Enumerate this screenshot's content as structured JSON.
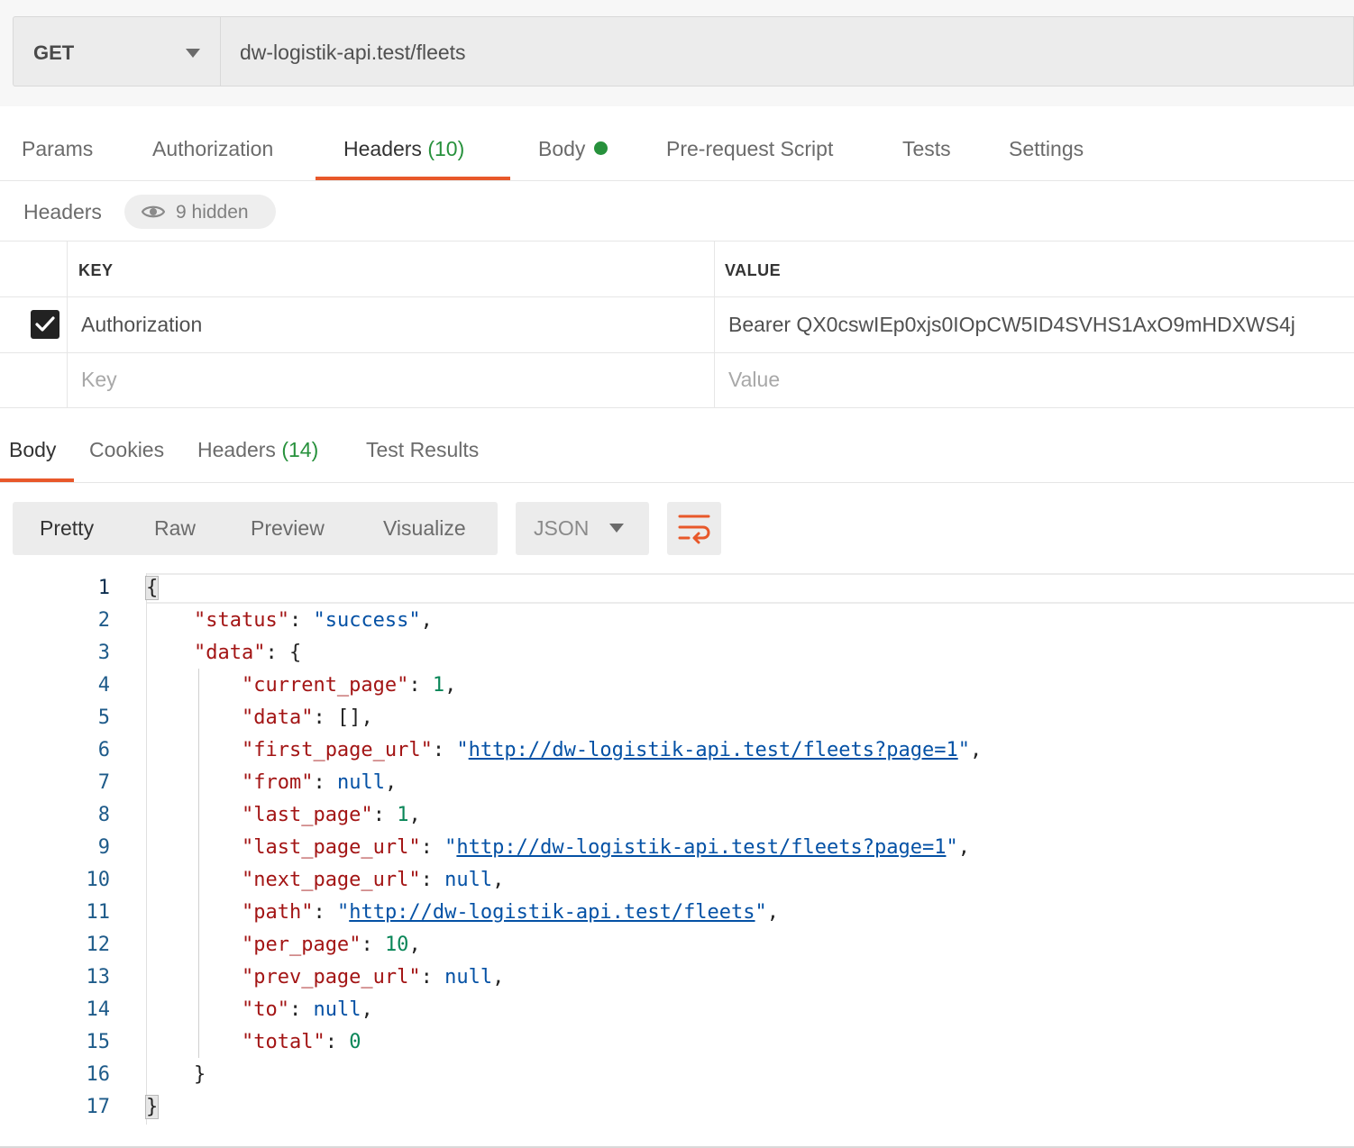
{
  "request": {
    "method": "GET",
    "url": "dw-logistik-api.test/fleets"
  },
  "request_tabs": [
    {
      "label": "Params",
      "count": ""
    },
    {
      "label": "Authorization",
      "count": ""
    },
    {
      "label": "Headers",
      "count": "(10)"
    },
    {
      "label": "Body",
      "count": ""
    },
    {
      "label": "Pre-request Script",
      "count": ""
    },
    {
      "label": "Tests",
      "count": ""
    },
    {
      "label": "Settings",
      "count": ""
    }
  ],
  "active_request_tab": "Headers",
  "body_has_content_color": "#27913c",
  "headers_section": {
    "label": "Headers",
    "hidden_label": "9 hidden",
    "columns": {
      "key": "KEY",
      "value": "VALUE"
    },
    "rows": [
      {
        "checked": true,
        "key": "Authorization",
        "value": "Bearer QX0cswIEp0xjs0IOpCW5ID4SVHS1AxO9mHDXWS4j"
      }
    ],
    "new_row": {
      "key_placeholder": "Key",
      "value_placeholder": "Value"
    }
  },
  "response_tabs": [
    {
      "label": "Body",
      "count": ""
    },
    {
      "label": "Cookies",
      "count": ""
    },
    {
      "label": "Headers",
      "count": "(14)"
    },
    {
      "label": "Test Results",
      "count": ""
    }
  ],
  "active_response_tab": "Body",
  "view_modes": [
    "Pretty",
    "Raw",
    "Preview",
    "Visualize"
  ],
  "active_view_mode": "Pretty",
  "format": "JSON",
  "accent_color": "#e8582a",
  "line_numbers": [
    "1",
    "2",
    "3",
    "4",
    "5",
    "6",
    "7",
    "8",
    "9",
    "10",
    "11",
    "12",
    "13",
    "14",
    "15",
    "16",
    "17"
  ],
  "response_json": {
    "status": "success",
    "data_key": "data",
    "fields": [
      {
        "key": "current_page",
        "value": "1",
        "kind": "number"
      },
      {
        "key": "data",
        "value": "[]",
        "kind": "plain"
      },
      {
        "key": "first_page_url",
        "value": "http://dw-logistik-api.test/fleets?page=1",
        "kind": "url"
      },
      {
        "key": "from",
        "value": "null",
        "kind": "null"
      },
      {
        "key": "last_page",
        "value": "1",
        "kind": "number"
      },
      {
        "key": "last_page_url",
        "value": "http://dw-logistik-api.test/fleets?page=1",
        "kind": "url"
      },
      {
        "key": "next_page_url",
        "value": "null",
        "kind": "null"
      },
      {
        "key": "path",
        "value": "http://dw-logistik-api.test/fleets",
        "kind": "url"
      },
      {
        "key": "per_page",
        "value": "10",
        "kind": "number"
      },
      {
        "key": "prev_page_url",
        "value": "null",
        "kind": "null"
      },
      {
        "key": "to",
        "value": "null",
        "kind": "null"
      },
      {
        "key": "total",
        "value": "0",
        "kind": "number"
      }
    ]
  }
}
